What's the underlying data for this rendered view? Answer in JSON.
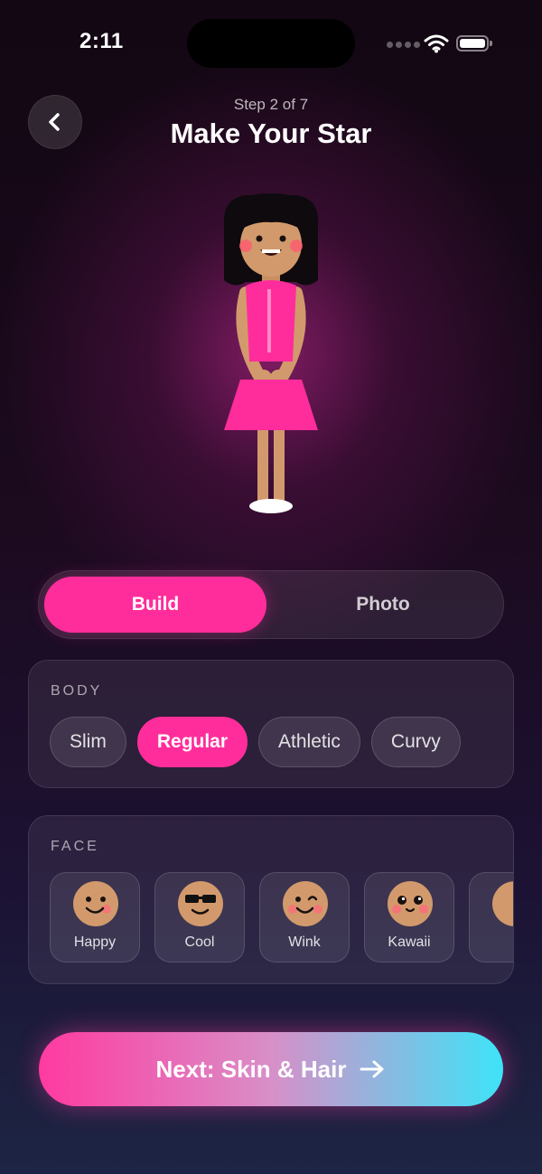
{
  "status_bar": {
    "time": "2:11"
  },
  "header": {
    "step": "Step 2 of 7",
    "title": "Make Your Star"
  },
  "tabs": [
    {
      "label": "Build",
      "active": true
    },
    {
      "label": "Photo",
      "active": false
    }
  ],
  "body_section": {
    "label": "BODY",
    "options": [
      "Slim",
      "Regular",
      "Athletic",
      "Curvy"
    ],
    "selected": "Regular"
  },
  "face_section": {
    "label": "FACE",
    "options": [
      {
        "name": "Happy",
        "icon": "happy-face-icon"
      },
      {
        "name": "Cool",
        "icon": "sunglasses-face-icon"
      },
      {
        "name": "Wink",
        "icon": "wink-face-icon"
      },
      {
        "name": "Kawaii",
        "icon": "kawaii-face-icon"
      }
    ]
  },
  "cta": {
    "label": "Next: Skin & Hair"
  },
  "colors": {
    "accent": "#ff2d9b",
    "cta_end": "#3ee3f8",
    "skin": "#d29a6c"
  }
}
